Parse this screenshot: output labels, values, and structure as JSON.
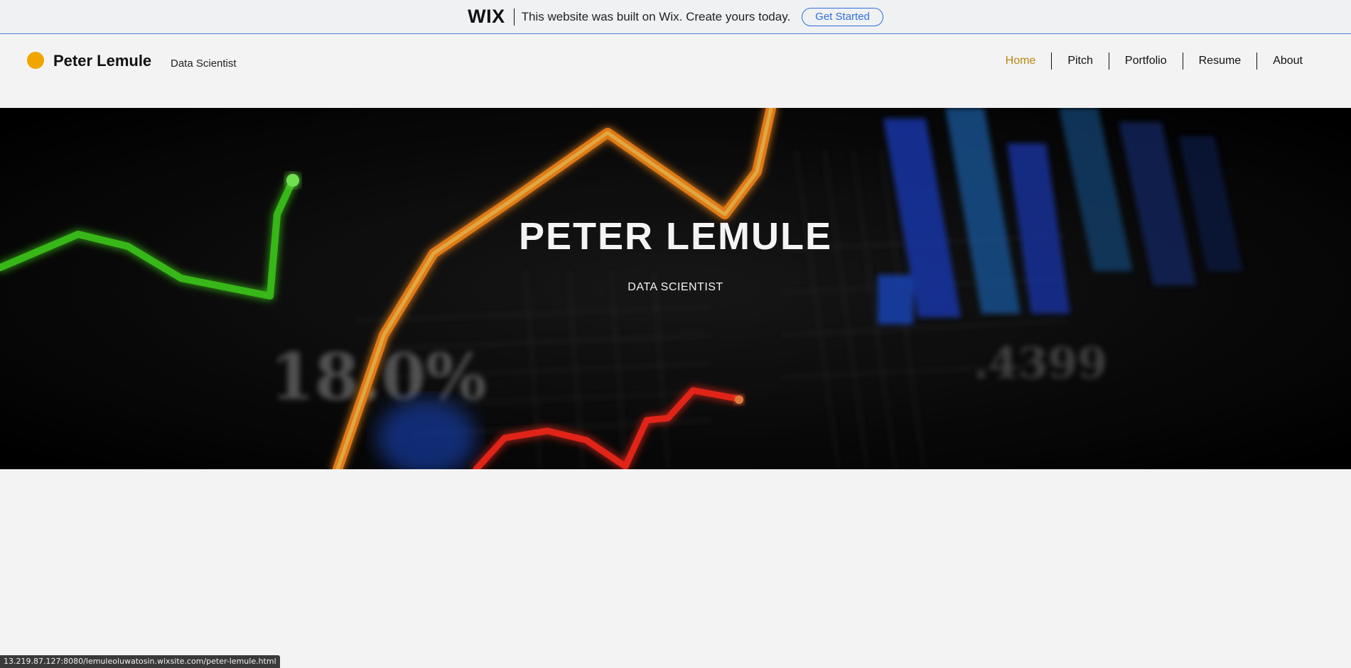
{
  "wix_banner": {
    "logo": "WIX",
    "message": "This website was built on Wix. Create yours today.",
    "cta_label": "Get Started"
  },
  "header": {
    "brand_name": "Peter Lemule",
    "brand_tagline": "Data Scientist",
    "brand_dot_color": "#f0a500",
    "nav": [
      {
        "label": "Home",
        "active": true
      },
      {
        "label": "Pitch",
        "active": false
      },
      {
        "label": "Portfolio",
        "active": false
      },
      {
        "label": "Resume",
        "active": false
      },
      {
        "label": "About",
        "active": false
      }
    ]
  },
  "hero": {
    "title": "PETER LEMULE",
    "subtitle": "DATA SCIENTIST",
    "bg_numbers": [
      "18.0%",
      ".4399"
    ]
  },
  "status_bar": {
    "url": "13.219.87.127:8080/lemuleoluwatosin.wixsite.com/peter-lemule.html"
  },
  "colors": {
    "accent": "#b8860b",
    "wix_blue": "#2f6fe0",
    "hero_orange": "#ff8c1a",
    "hero_green": "#3fd11f",
    "hero_red": "#ff2a1a",
    "hero_blue": "#1f4fd6"
  }
}
